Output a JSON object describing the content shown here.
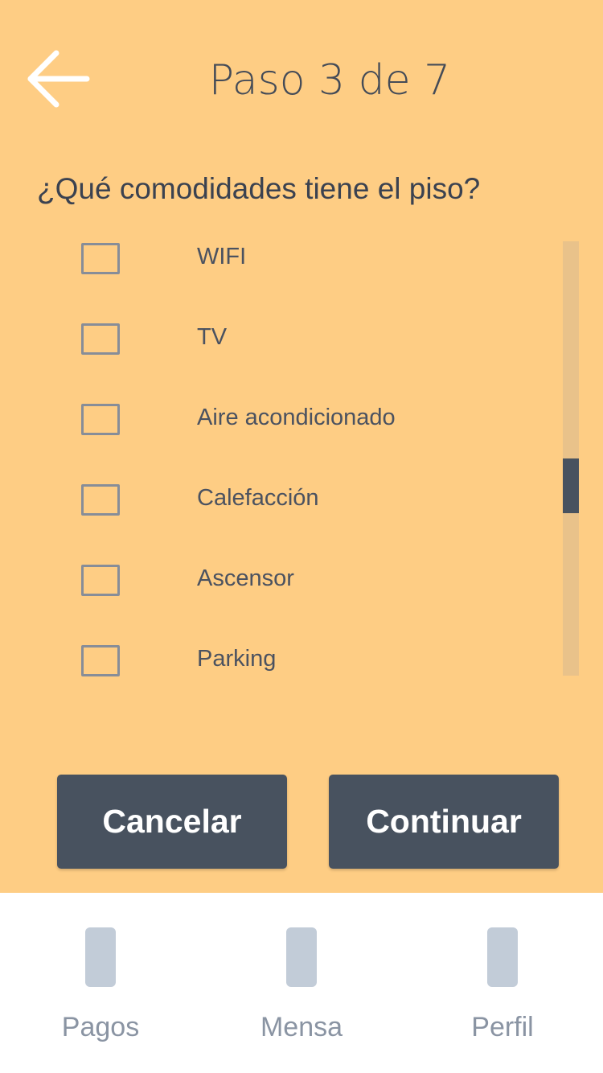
{
  "header": {
    "back_icon": "arrow-left-icon",
    "step_title": "Paso 3 de 7"
  },
  "question": "¿Qué comodidades tiene el piso?",
  "amenities": [
    {
      "label": "WIFI",
      "checked": false
    },
    {
      "label": "TV",
      "checked": false
    },
    {
      "label": "Aire acondicionado",
      "checked": false
    },
    {
      "label": "Calefacción",
      "checked": false
    },
    {
      "label": "Ascensor",
      "checked": false
    },
    {
      "label": "Parking",
      "checked": false
    }
  ],
  "actions": {
    "cancel_label": "Cancelar",
    "continue_label": "Continuar"
  },
  "tabbar": {
    "tabs": [
      {
        "label": "Pagos",
        "icon": "placeholder-icon"
      },
      {
        "label": "Mensa",
        "icon": "placeholder-icon"
      },
      {
        "label": "Perfil",
        "icon": "placeholder-icon"
      }
    ]
  },
  "colors": {
    "background": "#fecd84",
    "dark": "#48525f",
    "tab_icon": "#c2ccd8"
  }
}
